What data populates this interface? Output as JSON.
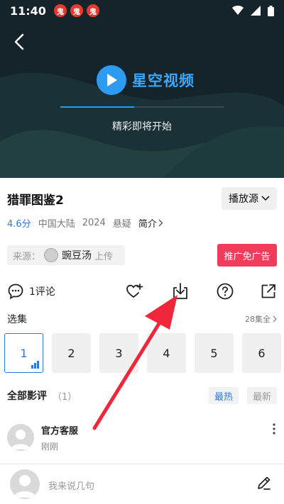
{
  "status": {
    "time": "11:40",
    "badges": [
      "鬼",
      "鬼",
      "鬼"
    ]
  },
  "player": {
    "logo_text": "星空视频",
    "progress": 0.45,
    "tip": "精彩即将开始"
  },
  "video": {
    "title": "猎罪图鉴2",
    "source_select_label": "播放源",
    "rating": "4.6分",
    "region": "中国大陆",
    "year": "2024",
    "genre": "悬疑",
    "intro_label": "简介"
  },
  "source": {
    "label": "来源：",
    "uploader": "豌豆汤",
    "upload_suffix": "上传"
  },
  "ad_free_label": "推广免广告",
  "actions": {
    "comment_count_label": "1评论"
  },
  "episodes": {
    "title": "选集",
    "total_label": "28集全",
    "items": [
      "1",
      "2",
      "3",
      "4",
      "5",
      "6"
    ],
    "active_index": 0
  },
  "comments": {
    "title": "全部影评",
    "count": "（1）",
    "sort_hot": "最热",
    "sort_new": "最新",
    "items": [
      {
        "name": "官方客服",
        "time": "刚刚"
      }
    ]
  },
  "input": {
    "placeholder": "我来说几句"
  },
  "colors": {
    "accent": "#2d7ad6",
    "ad": "#f23c5c",
    "arrow": "#f0263a",
    "player_bg": "#15242b"
  }
}
